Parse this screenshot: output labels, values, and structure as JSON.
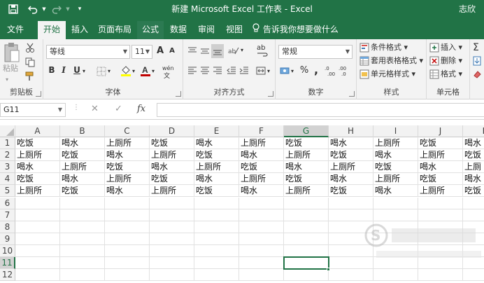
{
  "titlebar": {
    "title": "新建 Microsoft Excel 工作表  -  Excel",
    "user": "志欣",
    "icons": [
      "save-icon",
      "undo-icon",
      "redo-icon",
      "customize-qat-icon"
    ]
  },
  "tabs": [
    "文件",
    "开始",
    "插入",
    "页面布局",
    "公式",
    "数据",
    "审阅",
    "视图"
  ],
  "active_tab": "开始",
  "tell_me": "告诉我你想要做什么",
  "ribbon": {
    "clipboard": {
      "label": "剪贴板",
      "paste": "粘贴"
    },
    "font": {
      "label": "字体",
      "font_name": "等线",
      "font_size": "11",
      "grow": "A",
      "shrink": "A",
      "bold": "B",
      "italic": "I",
      "underline": "U",
      "phonetic": "wén"
    },
    "alignment": {
      "label": "对齐方式",
      "wrap": "ab"
    },
    "number": {
      "label": "数字",
      "format": "常规",
      "percent": "%",
      "comma": ","
    },
    "styles": {
      "label": "样式",
      "conditional": "条件格式",
      "table": "套用表格格式",
      "cell_styles": "单元格样式"
    },
    "cells": {
      "label": "单元格",
      "insert": "插入",
      "delete": "删除",
      "format": "格式"
    }
  },
  "formula_bar": {
    "name_box": "G11",
    "cancel": "✕",
    "enter": "✓",
    "fx": "fx",
    "value": ""
  },
  "columns": [
    "A",
    "B",
    "C",
    "D",
    "E",
    "F",
    "G",
    "H",
    "I",
    "J",
    "K"
  ],
  "rows": [
    "1",
    "2",
    "3",
    "4",
    "5",
    "6",
    "7",
    "8",
    "9",
    "10",
    "11",
    "12"
  ],
  "cells": [
    [
      "吃饭",
      "喝水",
      "上厕所",
      "吃饭",
      "喝水",
      "上厕所",
      "吃饭",
      "喝水",
      "上厕所",
      "吃饭",
      "喝水"
    ],
    [
      "上厕所",
      "吃饭",
      "喝水",
      "上厕所",
      "吃饭",
      "喝水",
      "上厕所",
      "吃饭",
      "喝水",
      "上厕所",
      "吃饭"
    ],
    [
      "喝水",
      "上厕所",
      "吃饭",
      "喝水",
      "上厕所",
      "吃饭",
      "喝水",
      "上厕所",
      "吃饭",
      "喝水",
      "上厕"
    ],
    [
      "吃饭",
      "喝水",
      "上厕所",
      "吃饭",
      "喝水",
      "上厕所",
      "吃饭",
      "喝水",
      "上厕所",
      "吃饭",
      "喝水"
    ],
    [
      "上厕所",
      "吃饭",
      "喝水",
      "上厕所",
      "吃饭",
      "喝水",
      "上厕所",
      "吃饭",
      "喝水",
      "上厕所",
      "吃饭"
    ]
  ],
  "selected_column": "G",
  "selected_row": "11",
  "colors": {
    "excel_green": "#217346",
    "ribbon_bg": "#f3f3f3",
    "font_color": "#c00000",
    "fill_color": "#ffff00"
  },
  "watermark": {
    "icon": "logo-s-icon"
  }
}
